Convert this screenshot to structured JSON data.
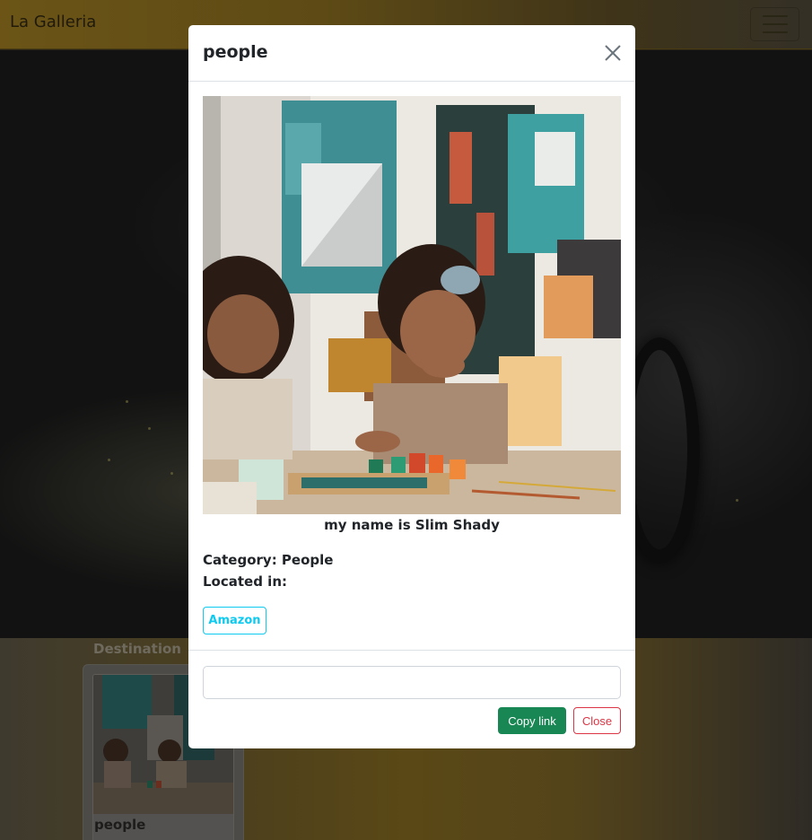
{
  "navbar": {
    "brand": "La Galleria",
    "toggler_icon": "hamburger-menu-icon"
  },
  "content": {
    "section_title": "Destination",
    "cards": [
      {
        "title": "people"
      }
    ]
  },
  "modal": {
    "title": "people",
    "close_icon": "close-icon",
    "caption": "my name is Slim Shady",
    "category_line": "Category: People",
    "location_line": "Located in:",
    "store_button": "Amazon",
    "link_value": "",
    "copy_button": "Copy link",
    "close_button": "Close"
  },
  "colors": {
    "success": "#198754",
    "danger": "#dc3545",
    "info": "#0dcaf0",
    "navbar": "#6b5416"
  }
}
